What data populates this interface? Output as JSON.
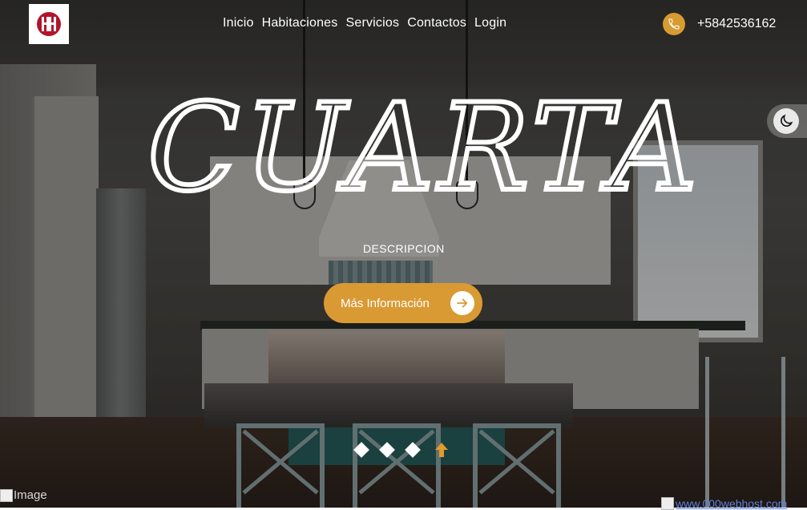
{
  "brand": {
    "logo_icon": "hh-monogram-logo",
    "accent": "#d99a33",
    "logo_red": "#b3142b"
  },
  "nav": {
    "items": [
      {
        "label": "Inicio"
      },
      {
        "label": "Habitaciones"
      },
      {
        "label": "Servicios"
      },
      {
        "label": "Contactos"
      },
      {
        "label": "Login"
      }
    ]
  },
  "contact": {
    "phone": "+5842536162",
    "icon": "phone-icon"
  },
  "theme_toggle": {
    "icon": "moon-icon"
  },
  "hero": {
    "title": "CUARTA",
    "description": "DESCRIPCION",
    "cta_label": "Más Información",
    "cta_icon": "arrow-right-icon"
  },
  "slider": {
    "dots": 3,
    "scroll_icon": "arrow-up-icon"
  },
  "footer": {
    "broken_image_alt": "Image",
    "badge_text": "www.000webhost.com"
  }
}
